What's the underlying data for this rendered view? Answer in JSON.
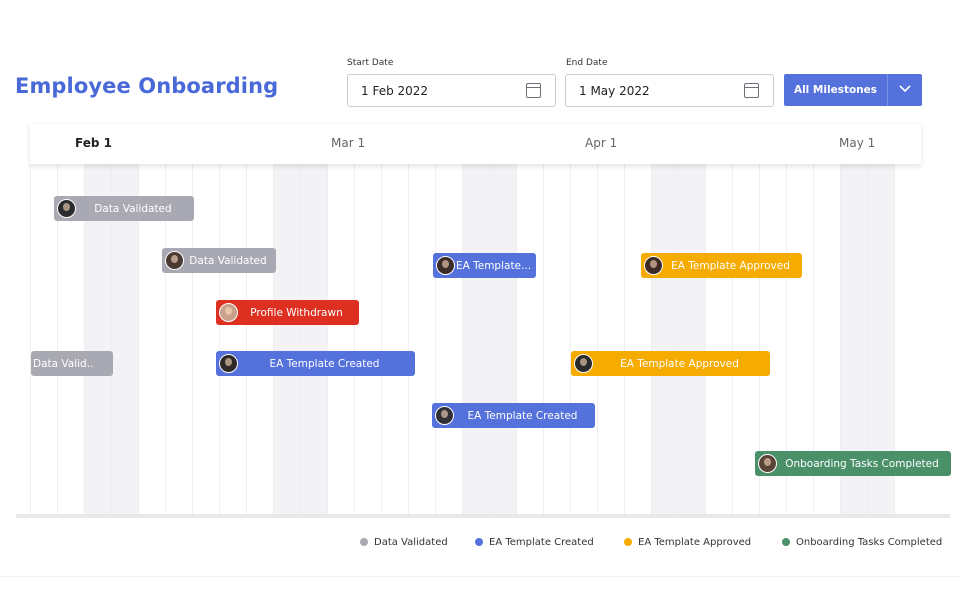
{
  "header": {
    "title": "Employee Onboarding",
    "start_date": {
      "label": "Start Date",
      "value": "1 Feb 2022"
    },
    "end_date": {
      "label": "End Date",
      "value": "1 May 2022"
    },
    "milestones_button": "All Milestones"
  },
  "timeline": {
    "months": [
      {
        "label": "Feb 1",
        "bold": true
      },
      {
        "label": "Mar 1",
        "bold": false
      },
      {
        "label": "Apr 1",
        "bold": false
      },
      {
        "label": "May 1",
        "bold": false
      }
    ],
    "bars": [
      {
        "label": "Data Validated",
        "status": "data-validated"
      },
      {
        "label": "Data Validated",
        "status": "data-validated"
      },
      {
        "label": "EA Template...",
        "status": "ea-template-created"
      },
      {
        "label": "EA Template Approved",
        "status": "ea-template-approved"
      },
      {
        "label": "Profile Withdrawn",
        "status": "profile-withdrawn"
      },
      {
        "label": "Data Valid..",
        "status": "data-validated"
      },
      {
        "label": "EA Template Created",
        "status": "ea-template-created"
      },
      {
        "label": "EA Template Approved",
        "status": "ea-template-approved"
      },
      {
        "label": "EA Template Created",
        "status": "ea-template-created"
      },
      {
        "label": "Onboarding Tasks Completed",
        "status": "onboarding-tasks-completed"
      }
    ]
  },
  "legend": [
    {
      "label": "Data Validated",
      "color": "#a9a9b3"
    },
    {
      "label": "EA Template Created",
      "color": "#5471dc"
    },
    {
      "label": "EA Template Approved",
      "color": "#f5ab00"
    },
    {
      "label": "Onboarding Tasks Completed",
      "color": "#4a9169"
    }
  ],
  "colors": {
    "accent": "#5471dc",
    "title": "#4a69d8",
    "data_validated": "#a9a9b3",
    "ea_template_created": "#5471dc",
    "ea_template_approved": "#f5ab00",
    "profile_withdrawn": "#dd3020",
    "onboarding_tasks_completed": "#4a9169"
  },
  "icons": [
    "calendar-icon",
    "chevron-down-icon",
    "avatar"
  ]
}
